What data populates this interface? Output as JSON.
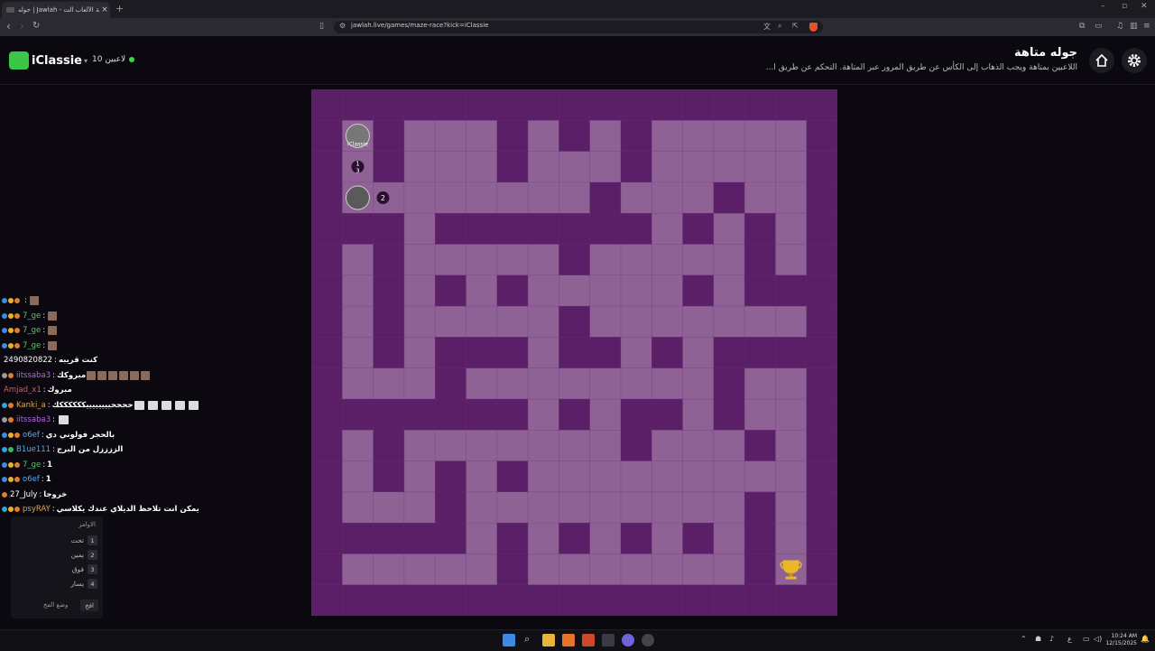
{
  "browser": {
    "tab_title": "جوله | Jawlah - منصة الألعاب الت...",
    "url": "jawlah.live/games/maze-race?kick=iClassie",
    "new_tab": "+",
    "tab_close": "×"
  },
  "header": {
    "logo_text": "iClassie",
    "players_count": "10 لاعبين",
    "title": "جوله متاهة",
    "description": "اللاعبين بمتاهة ويجب الذهاب إلى الكأس عن طريق المرور عبر المتاهة. التحكم عن طريق ا..."
  },
  "maze": {
    "wall_color": "#5a1f66",
    "path_color": "#8e6295",
    "grid_color": "#6e2f7a",
    "rows": [
      "#################",
      "#P#...#.#.#.....#",
      "#P#...#...#.....#",
      "#P.......#...#..#",
      "###.#######.#.#.#",
      "#.#.....#.....#.#",
      "#.#.#.#.....#.###",
      "#.#.....#.......#",
      "#.#.###.##.#.####",
      "#...#........#..#",
      "#######.#.##.#..#",
      "#.#.......#...#.#",
      "#.#.#.#.........#",
      "#...#.........#.#",
      "#####.#.#.#.#.#.#",
      "#.....#.......#T#",
      "#################"
    ],
    "player_name": "iClassie",
    "stack_labels": [
      "1",
      "3"
    ],
    "player2_label": "2"
  },
  "chat": [
    {
      "user": "",
      "color": "#62c26a",
      "text": "",
      "icons": [
        "badge-blue",
        "badge-gold",
        "badge-orange"
      ],
      "emotes": 1
    },
    {
      "user": "7_ge",
      "color": "#62c26a",
      "text": "",
      "icons": [
        "badge-blue",
        "badge-gold",
        "badge-orange"
      ],
      "emotes": 1
    },
    {
      "user": "7_ge",
      "color": "#62c26a",
      "text": "",
      "icons": [
        "badge-blue",
        "badge-gold",
        "badge-orange"
      ],
      "emotes": 1
    },
    {
      "user": "7_ge",
      "color": "#62c26a",
      "text": "",
      "icons": [
        "badge-blue",
        "badge-gold",
        "badge-orange"
      ],
      "emotes": 1
    },
    {
      "user": "2490820822",
      "color": "#ffffff",
      "text": "كنت قريبه",
      "icons": [],
      "emotes": 0
    },
    {
      "user": "iitssaba3",
      "color": "#b667e6",
      "text": "مبروكك",
      "icons": [
        "badge-sword",
        "badge-orange"
      ],
      "emotes": 6
    },
    {
      "user": "Amjad_x1",
      "color": "#e0556b",
      "text": "مبروك",
      "icons": [],
      "emotes": 0
    },
    {
      "user": "Kanki_a",
      "color": "#e0a64a",
      "text": "ححححييييييييككككككك",
      "icons": [
        "badge-cyan",
        "badge-orange"
      ],
      "emotes": 0,
      "emotes2": 5
    },
    {
      "user": "iitssaba3",
      "color": "#b667e6",
      "text": "",
      "icons": [
        "badge-sword",
        "badge-orange"
      ],
      "emotes": 0,
      "emotes2": 1
    },
    {
      "user": "o6ef",
      "color": "#5aa7e8",
      "text": "بالحجر فولوني دي",
      "icons": [
        "badge-blue",
        "badge-gold",
        "badge-orange"
      ],
      "emotes": 0
    },
    {
      "user": "B1ue111",
      "color": "#5aa7e8",
      "text": "الززززل من البرج",
      "icons": [
        "badge-cyan",
        "badge-green"
      ],
      "emotes": 0
    },
    {
      "user": "7_ge",
      "color": "#62c26a",
      "text": "1",
      "icons": [
        "badge-blue",
        "badge-gold",
        "badge-orange"
      ],
      "emotes": 0
    },
    {
      "user": "o6ef",
      "color": "#5aa7e8",
      "text": "1",
      "icons": [
        "badge-blue",
        "badge-gold",
        "badge-orange"
      ],
      "emotes": 0
    },
    {
      "user": "27_July",
      "color": "#ffffff",
      "text": "خروجا",
      "icons": [
        "badge-fire"
      ],
      "emotes": 0
    },
    {
      "user": "psyRAY",
      "color": "#e0a64a",
      "text": "يمكن انت تلاحظ الديلاي عندك يكلاسي",
      "icons": [
        "badge-cyan",
        "badge-gold",
        "badge-orange"
      ],
      "emotes": 0
    }
  ],
  "commands": {
    "title": "الاوامر",
    "items": [
      {
        "num": "1",
        "label": "تحت"
      },
      {
        "num": "2",
        "label": "يمين"
      },
      {
        "num": "3",
        "label": "فوق"
      },
      {
        "num": "4",
        "label": "يسار"
      }
    ],
    "footer_label": "وضع الفخ",
    "footer_button": "افخ"
  },
  "taskbar": {
    "time": "10:24 AM",
    "date": "12/15/2025",
    "lang": "ع"
  },
  "colors": {
    "badge-blue": "#3d8be0",
    "badge-gold": "#e6b423",
    "badge-orange": "#e07e2a",
    "badge-cyan": "#2aa9d8",
    "badge-green": "#38b56a",
    "badge-sword": "#9a9a9a",
    "badge-fire": "#e07e2a"
  }
}
